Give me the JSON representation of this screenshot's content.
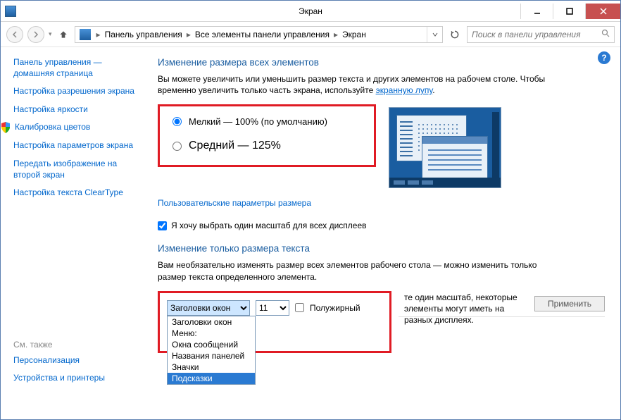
{
  "window": {
    "title": "Экран"
  },
  "breadcrumb": {
    "root_chevron": "▸",
    "items": [
      "Панель управления",
      "Все элементы панели управления",
      "Экран"
    ]
  },
  "search": {
    "placeholder": "Поиск в панели управления"
  },
  "sidebar": {
    "items": [
      "Панель управления — домашняя страница",
      "Настройка разрешения экрана",
      "Настройка яркости",
      "Калибровка цветов",
      "Настройка параметров экрана",
      "Передать изображение на второй экран",
      "Настройка текста ClearType"
    ],
    "see_also_label": "См. также",
    "see_also_items": [
      "Персонализация",
      "Устройства и принтеры"
    ]
  },
  "content": {
    "heading1": "Изменение размера всех элементов",
    "desc1_pre": "Вы можете увеличить или уменьшить размер текста и других элементов на рабочем столе. Чтобы временно увеличить только часть экрана, используйте ",
    "desc1_link": "экранную лупу",
    "desc1_post": ".",
    "radio_small": "Мелкий — 100% (по умолчанию)",
    "radio_medium": "Средний — 125%",
    "custom_link": "Пользовательские параметры размера",
    "single_scale_chk": "Я хочу выбрать один масштаб для всех дисплеев",
    "heading2": "Изменение только размера текста",
    "desc2": "Вам необязательно изменять размер всех элементов рабочего стола — можно изменить только размер текста определенного элемента.",
    "element_selected": "Заголовки окон",
    "size_selected": "11",
    "bold_label": "Полужирный",
    "dropdown_options": [
      "Заголовки окон",
      "Меню:",
      "Окна сообщений",
      "Названия панелей",
      "Значки",
      "Подсказки"
    ],
    "dropdown_highlight": "Подсказки",
    "note_text": "те один масштаб, некоторые элементы могут иметь на разных дисплеях.",
    "apply_label": "Применить"
  }
}
